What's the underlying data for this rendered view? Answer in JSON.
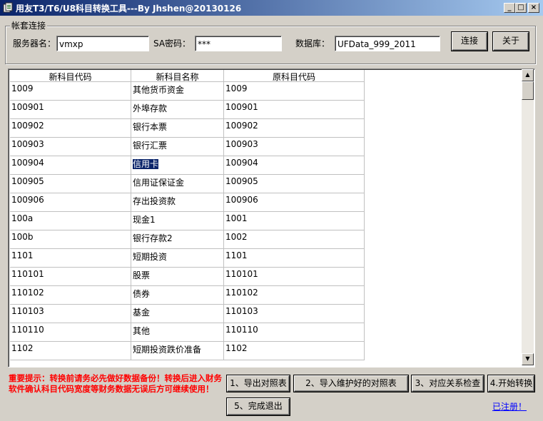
{
  "window": {
    "title": "用友T3/T6/U8科目转换工具---By Jhshen@20130126",
    "minimize_glyph": "_",
    "maximize_glyph": "□",
    "close_glyph": "×"
  },
  "connection": {
    "group_label": "帐套连接",
    "server_label": "服务器名：",
    "server_value": "vmxp",
    "sa_label": "SA密码：",
    "sa_value": "***",
    "db_label": "数据库：",
    "db_value": "UFData_999_2011",
    "connect_button": "连接",
    "about_button": "关于"
  },
  "grid": {
    "columns": [
      "新科目代码",
      "新科目名称",
      "原科目代码"
    ],
    "rows": [
      [
        "1009",
        "其他货币资金",
        "1009"
      ],
      [
        "100901",
        "外埠存款",
        "100901"
      ],
      [
        "100902",
        "银行本票",
        "100902"
      ],
      [
        "100903",
        "银行汇票",
        "100903"
      ],
      [
        "100904",
        "信用卡",
        "100904"
      ],
      [
        "100905",
        "信用证保证金",
        "100905"
      ],
      [
        "100906",
        "存出投资款",
        "100906"
      ],
      [
        "100a",
        "现金1",
        "1001"
      ],
      [
        "100b",
        "银行存款2",
        "1002"
      ],
      [
        "1101",
        "短期投资",
        "1101"
      ],
      [
        "110101",
        "股票",
        "110101"
      ],
      [
        "110102",
        "债券",
        "110102"
      ],
      [
        "110103",
        "基金",
        "110103"
      ],
      [
        "110110",
        "其他",
        "110110"
      ],
      [
        "1102",
        "短期投资跌价准备",
        "1102"
      ]
    ],
    "selected_row": 4,
    "selected_col": 1
  },
  "footer": {
    "warning": "重要提示：转换前请务必先做好数据备份！转换后进入财务软件确认科目代码宽度等财务数据无误后方可继续使用！",
    "btn_export": "1、导出对照表",
    "btn_import": "2、导入维护好的对照表",
    "btn_check": "3、对应关系检查",
    "btn_convert": "4.开始转换",
    "btn_exit": "5、完成退出",
    "registered_link": "已注册！"
  },
  "colors": {
    "warning": "#ff0000",
    "link": "#0000ff",
    "selection": "#0a246a",
    "titlebar": "#0a246a"
  }
}
